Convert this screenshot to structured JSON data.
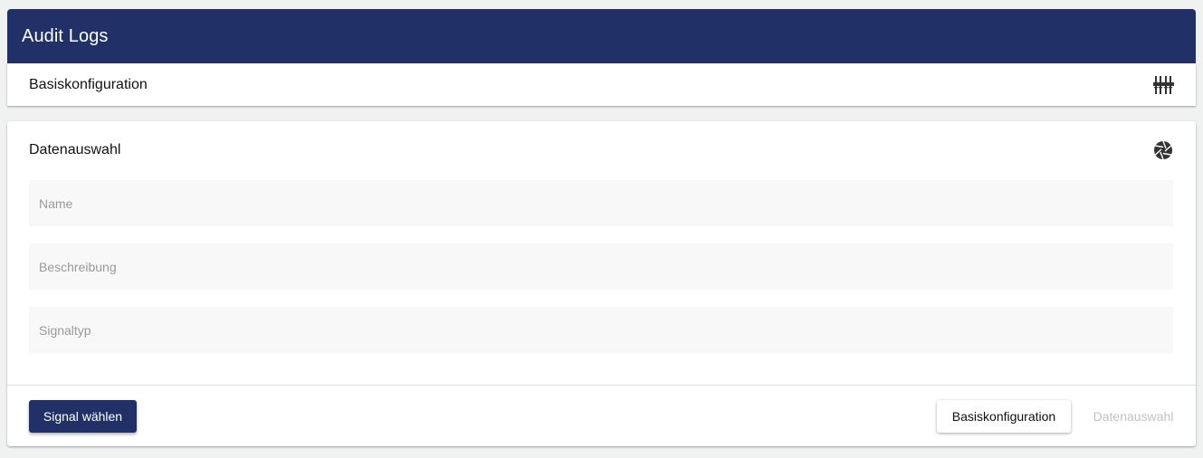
{
  "header": {
    "title": "Audit Logs",
    "color": "#213167"
  },
  "basis_panel": {
    "title": "Basiskonfiguration",
    "icon": "sliders-icon"
  },
  "data_panel": {
    "title": "Datenauswahl",
    "icon": "aperture-icon",
    "fields": [
      {
        "placeholder": "Name",
        "value": ""
      },
      {
        "placeholder": "Beschreibung",
        "value": ""
      },
      {
        "placeholder": "Signaltyp",
        "value": ""
      }
    ]
  },
  "actions": {
    "primary_label": "Signal wählen",
    "back_label": "Basiskonfiguration",
    "next_label": "Datenauswahl",
    "next_disabled": true
  }
}
